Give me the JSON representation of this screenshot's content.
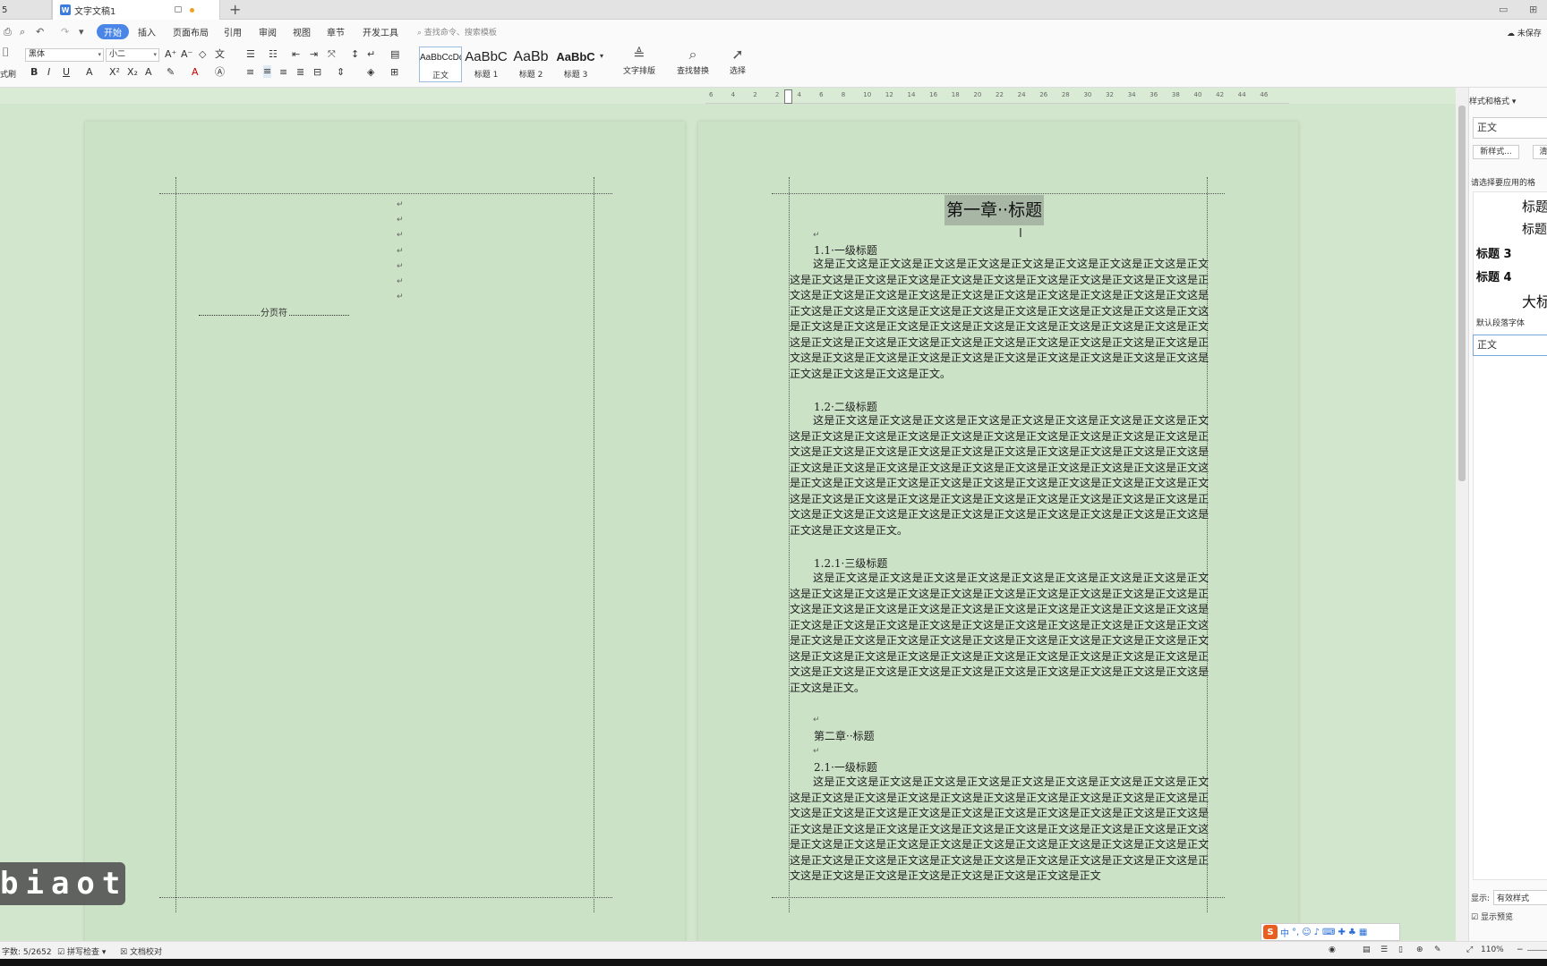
{
  "tabs": {
    "inactive_label": "5",
    "active_label": "文字文稿1",
    "doc_icon": "W"
  },
  "menu": {
    "items": [
      "开始",
      "插入",
      "页面布局",
      "引用",
      "审阅",
      "视图",
      "章节",
      "开发工具"
    ],
    "search_placeholder": "查找命令、搜索模板",
    "unsaved": "未保存"
  },
  "ribbon": {
    "format_painter": "式刷",
    "font_name": "黑体",
    "font_size": "小二",
    "styles": [
      {
        "sample": "AaBbCcDd",
        "label": "正文"
      },
      {
        "sample": "AaBbC",
        "label": "标题 1"
      },
      {
        "sample": "AaBb",
        "label": "标题 2"
      },
      {
        "sample": "AaBbC",
        "label": "标题 3"
      }
    ],
    "text_layout": "文字排版",
    "find_replace": "查找替换",
    "select": "选择"
  },
  "ruler_ticks": [
    "6",
    "4",
    "2",
    "2",
    "4",
    "6",
    "8",
    "10",
    "12",
    "14",
    "16",
    "18",
    "20",
    "22",
    "24",
    "26",
    "28",
    "30",
    "32",
    "34",
    "36",
    "38",
    "40",
    "42",
    "44",
    "46"
  ],
  "left_page": {
    "page_break": "分页符"
  },
  "right_page": {
    "chapter1_title": "第一章··标题",
    "h_1_1": "1.1·一级标题",
    "para_1": "这是正文这是正文这是正文这是正文这是正文这是正文这是正文这是正文这是正文这是正文这是正文这是正文这是正文这是正文这是正文这是正文这是正文这是正文这是正文这是正文这是正文这是正文这是正文这是正文这是正文这是正文这是正文这是正文这是正文这是正文这是正文这是正文这是正文这是正文这是正文这是正文这是正文这是正文这是正文这是正文这是正文这是正文这是正文这是正文这是正文这是正文这是正文这是正文这是正文这是正文这是正文这是正文这是正文这是正文这是正文这是正文这是正文这是正文这是正文这是正文这是正文这是正文这是正文这是正文这是正文这是正文这是正文这是正文这是正文这是正文这是正文。",
    "h_1_2": "1.2·二级标题",
    "para_2": "这是正文这是正文这是正文这是正文这是正文这是正文这是正文这是正文这是正文这是正文这是正文这是正文这是正文这是正文这是正文这是正文这是正文这是正文这是正文这是正文这是正文这是正文这是正文这是正文这是正文这是正文这是正文这是正文这是正文这是正文这是正文这是正文这是正文这是正文这是正文这是正文这是正文这是正文这是正文这是正文这是正文这是正文这是正文这是正文这是正文这是正文这是正文这是正文这是正文这是正文这是正文这是正文这是正文这是正文这是正文这是正文这是正文这是正文这是正文这是正文这是正文这是正文这是正文这是正文这是正文这是正文这是正文这是正文这是正文这是正文。",
    "h_1_2_1": "1.2.1·三级标题",
    "para_3": "这是正文这是正文这是正文这是正文这是正文这是正文这是正文这是正文这是正文这是正文这是正文这是正文这是正文这是正文这是正文这是正文这是正文这是正文这是正文这是正文这是正文这是正文这是正文这是正文这是正文这是正文这是正文这是正文这是正文这是正文这是正文这是正文这是正文这是正文这是正文这是正文这是正文这是正文这是正文这是正文这是正文这是正文这是正文这是正文这是正文这是正文这是正文这是正文这是正文这是正文这是正文这是正文这是正文这是正文这是正文这是正文这是正文这是正文这是正文这是正文这是正文这是正文这是正文这是正文这是正文这是正文这是正文这是正文这是正文。",
    "chapter2_title": "第二章··标题",
    "h_2_1": "2.1·一级标题",
    "para_4": "这是正文这是正文这是正文这是正文这是正文这是正文这是正文这是正文这是正文这是正文这是正文这是正文这是正文这是正文这是正文这是正文这是正文这是正文这是正文这是正文这是正文这是正文这是正文这是正文这是正文这是正文这是正文这是正文这是正文这是正文这是正文这是正文这是正文这是正文这是正文这是正文这是正文这是正文这是正文这是正文这是正文这是正文这是正文这是正文这是正文这是正文这是正文这是正文这是正文这是正文这是正文这是正文这是正文这是正文这是正文这是正文这是正文这是正文这是正文这是正文这是正文这是正文这是正文这是正文这是正文"
  },
  "side_panel": {
    "title": "样式和格式",
    "current_style": "正文",
    "new_style_btn": "新样式...",
    "clear_btn": "清",
    "prompt": "请选择要应用的格",
    "list": [
      "标题",
      "标题",
      "标题 3",
      "标题 4",
      "大标"
    ],
    "default_para_font": "默认段落字体",
    "list_selected": "正文",
    "show_label": "显示:",
    "show_value": "有效样式",
    "preview_label": "显示预览"
  },
  "statusbar": {
    "word_count": "字数: 5/2652",
    "spell_check": "拼写检查",
    "doc_proof": "文档校对",
    "zoom": "110%"
  },
  "ime": {
    "logo": "S",
    "mode": "中"
  },
  "overlay_text": "biaoti",
  "colors": {
    "accent": "#4a86e8",
    "page_bg": "#cbe2c6",
    "workspace_bg": "#d2e6cd",
    "selection": "#a8b7a5"
  }
}
